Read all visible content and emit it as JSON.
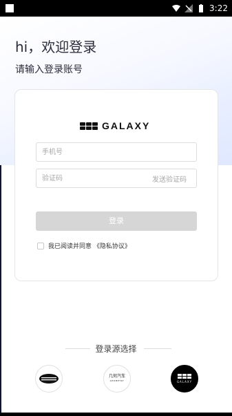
{
  "status_bar": {
    "time": "3:22",
    "icons": [
      "notification-icon",
      "wifi-icon",
      "signal-off-icon",
      "battery-icon"
    ]
  },
  "header": {
    "greeting": "hi，欢迎登录",
    "subtitle": "请输入登录账号"
  },
  "login_card": {
    "brand_text": "GALAXY",
    "phone_placeholder": "手机号",
    "code_placeholder": "验证码",
    "send_code_label": "发送验证码",
    "login_button_label": "登录",
    "agreement_text": "我已阅读并同意 《隐私协议》"
  },
  "login_source": {
    "title": "登录源选择",
    "options": [
      {
        "name": "geely",
        "label": ""
      },
      {
        "name": "geometry",
        "label_top": "几何汽车",
        "label_bottom": "GEOMETRY"
      },
      {
        "name": "galaxy",
        "label": "GALAXY"
      }
    ]
  },
  "colors": {
    "button_disabled": "#d6d6d6",
    "accent_bg": "#e9efff",
    "text_dark": "#2a2d3a"
  }
}
